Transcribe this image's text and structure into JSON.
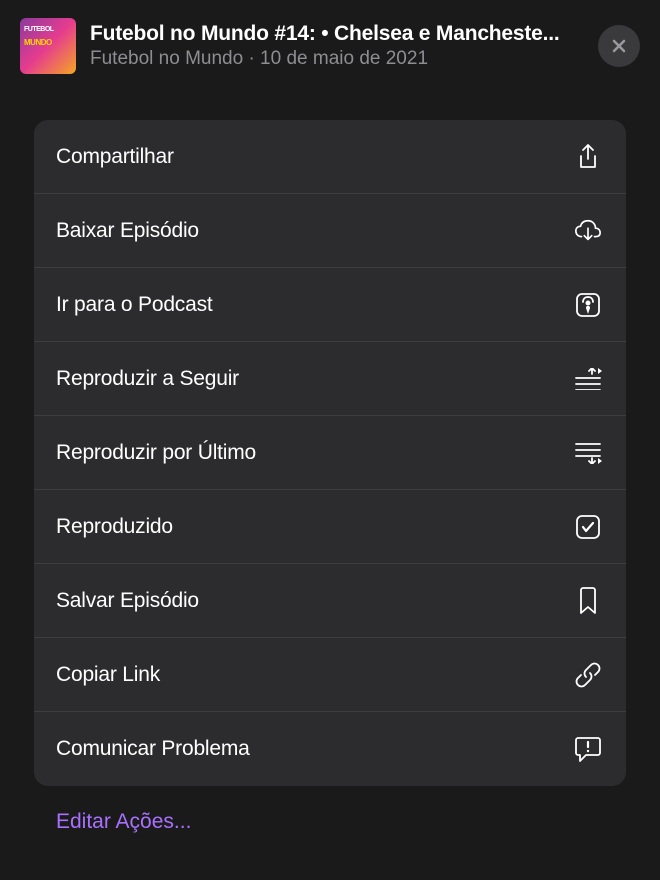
{
  "header": {
    "title": "Futebol no Mundo #14: • Chelsea e Mancheste...",
    "subtitle": "Futebol no Mundo · 10 de maio de 2021"
  },
  "menu": {
    "items": [
      {
        "label": "Compartilhar",
        "icon": "share-icon"
      },
      {
        "label": "Baixar Episódio",
        "icon": "download-cloud-icon"
      },
      {
        "label": "Ir para o Podcast",
        "icon": "podcast-icon"
      },
      {
        "label": "Reproduzir a Seguir",
        "icon": "play-next-icon"
      },
      {
        "label": "Reproduzir por Último",
        "icon": "play-last-icon"
      },
      {
        "label": "Reproduzido",
        "icon": "checkbox-checked-icon"
      },
      {
        "label": "Salvar Episódio",
        "icon": "bookmark-icon"
      },
      {
        "label": "Copiar Link",
        "icon": "link-icon"
      },
      {
        "label": "Comunicar Problema",
        "icon": "report-icon"
      }
    ]
  },
  "footer": {
    "edit_label": "Editar Ações..."
  }
}
